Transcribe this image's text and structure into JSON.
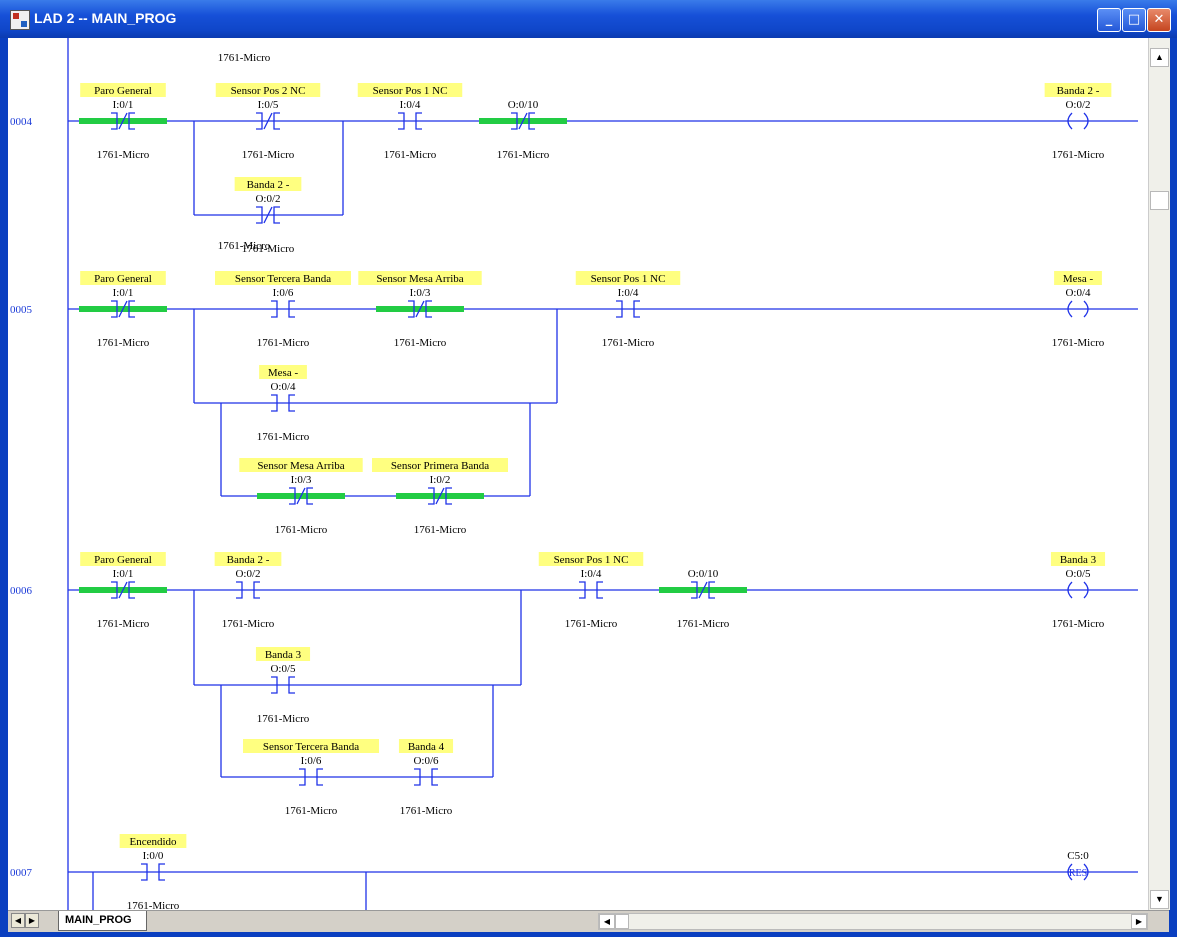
{
  "window": {
    "title": "LAD 2 -- MAIN_PROG"
  },
  "tab": {
    "label": "MAIN_PROG"
  },
  "colors": {
    "wire": "#1f32e8",
    "energized": "#22cc44",
    "label_bg": "#ffff80",
    "rung_number": "#1a3ad8"
  },
  "top_label": "1761-Micro",
  "rungs": [
    {
      "number": "0004",
      "elements": [
        {
          "kind": "contact",
          "type": "nc",
          "label": "Paro General",
          "addr": "I:0/1",
          "bottom": "1761-Micro",
          "energized": true
        },
        {
          "kind": "contact",
          "type": "nc",
          "label": "Sensor Pos 2 NC",
          "addr": "I:0/5",
          "bottom": "1761-Micro",
          "energized": false
        },
        {
          "kind": "contact",
          "type": "nc",
          "label": "Banda 2 -",
          "addr": "O:0/2",
          "bottom": "1761-Micro",
          "energized": false
        },
        {
          "kind": "contact",
          "type": "no",
          "label": "Sensor Pos 1 NC",
          "addr": "I:0/4",
          "bottom": "1761-Micro",
          "energized": false
        },
        {
          "kind": "contact",
          "type": "nc",
          "label": "",
          "addr": "O:0/10",
          "bottom": "1761-Micro",
          "energized": true
        },
        {
          "kind": "coil",
          "label": "Banda 2 -",
          "addr": "O:0/2",
          "bottom": "1761-Micro"
        }
      ]
    },
    {
      "number": "0005",
      "elements": [
        {
          "kind": "contact",
          "type": "nc",
          "label": "Paro General",
          "addr": "I:0/1",
          "bottom": "1761-Micro",
          "energized": true
        },
        {
          "kind": "contact",
          "type": "no",
          "label": "Sensor Tercera Banda",
          "addr": "I:0/6",
          "bottom": "1761-Micro",
          "energized": false
        },
        {
          "kind": "contact",
          "type": "nc",
          "label": "Sensor Mesa Arriba",
          "addr": "I:0/3",
          "bottom": "1761-Micro",
          "energized": true
        },
        {
          "kind": "contact",
          "type": "no",
          "label": "Mesa -",
          "addr": "O:0/4",
          "bottom": "1761-Micro",
          "energized": false
        },
        {
          "kind": "contact",
          "type": "nc",
          "label": "Sensor Mesa Arriba",
          "addr": "I:0/3",
          "bottom": "1761-Micro",
          "energized": true
        },
        {
          "kind": "contact",
          "type": "nc",
          "label": "Sensor Primera Banda",
          "addr": "I:0/2",
          "bottom": "1761-Micro",
          "energized": true
        },
        {
          "kind": "contact",
          "type": "no",
          "label": "Sensor Pos 1 NC",
          "addr": "I:0/4",
          "bottom": "1761-Micro",
          "energized": false
        },
        {
          "kind": "coil",
          "label": "Mesa -",
          "addr": "O:0/4",
          "bottom": "1761-Micro"
        }
      ]
    },
    {
      "number": "0006",
      "elements": [
        {
          "kind": "contact",
          "type": "nc",
          "label": "Paro General",
          "addr": "I:0/1",
          "bottom": "1761-Micro",
          "energized": true
        },
        {
          "kind": "contact",
          "type": "no",
          "label": "Banda 2 -",
          "addr": "O:0/2",
          "bottom": "1761-Micro",
          "energized": false
        },
        {
          "kind": "contact",
          "type": "no",
          "label": "Banda 3",
          "addr": "O:0/5",
          "bottom": "1761-Micro",
          "energized": false
        },
        {
          "kind": "contact",
          "type": "no",
          "label": "Sensor Tercera Banda",
          "addr": "I:0/6",
          "bottom": "1761-Micro",
          "energized": false
        },
        {
          "kind": "contact",
          "type": "no",
          "label": "Banda 4",
          "addr": "O:0/6",
          "bottom": "1761-Micro",
          "energized": false
        },
        {
          "kind": "contact",
          "type": "no",
          "label": "Sensor Pos 1 NC",
          "addr": "I:0/4",
          "bottom": "1761-Micro",
          "energized": false
        },
        {
          "kind": "contact",
          "type": "nc",
          "label": "",
          "addr": "O:0/10",
          "bottom": "1761-Micro",
          "energized": true
        },
        {
          "kind": "coil",
          "label": "Banda 3",
          "addr": "O:0/5",
          "bottom": "1761-Micro"
        }
      ]
    },
    {
      "number": "0007",
      "elements": [
        {
          "kind": "contact",
          "type": "no",
          "label": "Encendido",
          "addr": "I:0/0",
          "bottom": "1761-Micro",
          "energized": false
        },
        {
          "kind": "coil_res",
          "label": "",
          "addr": "C5:0",
          "text": "RES",
          "bottom": ""
        }
      ]
    }
  ]
}
